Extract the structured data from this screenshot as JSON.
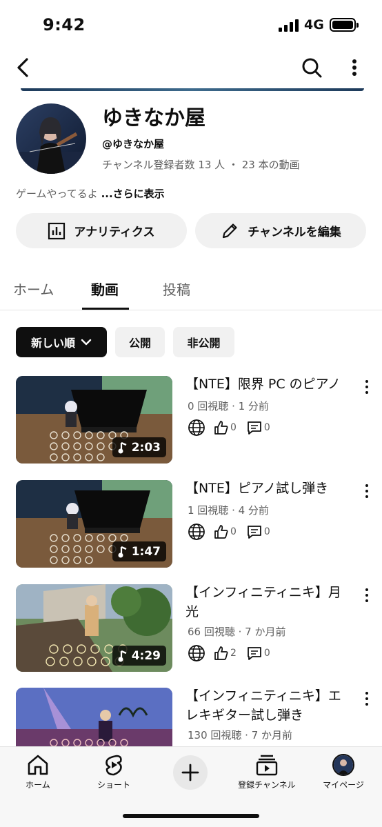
{
  "status": {
    "time": "9:42",
    "network": "4G"
  },
  "channel": {
    "name": "ゆきなか屋",
    "handle": "@ゆきなか屋",
    "meta": "チャンネル登録者数 13 人 ・ 23 本の動画",
    "description": "ゲームやってるよ ",
    "description_more": "...さらに表示"
  },
  "buttons": {
    "analytics": "アナリティクス",
    "edit_channel": "チャンネルを編集"
  },
  "tabs": [
    "ホーム",
    "動画",
    "投稿"
  ],
  "active_tab": "動画",
  "filters": {
    "sort": "新しい順",
    "public": "公開",
    "private": "非公開"
  },
  "videos": [
    {
      "title": "【NTE】限界 PC のピアノ",
      "meta": "0 回視聴 · 1 分前",
      "duration": "2:03",
      "likes": "0",
      "comments": "0"
    },
    {
      "title": "【NTE】ピアノ試し弾き",
      "meta": "1 回視聴 · 4 分前",
      "duration": "1:47",
      "likes": "0",
      "comments": "0"
    },
    {
      "title": "【インフィニティニキ】月光",
      "meta": "66 回視聴 · 7 か月前",
      "duration": "4:29",
      "likes": "2",
      "comments": "0"
    },
    {
      "title": "【インフィニティニキ】エレキギター試し弾き",
      "meta": "130 回視聴 · 7 か月前"
    }
  ],
  "nav": {
    "home": "ホーム",
    "shorts": "ショート",
    "subscriptions": "登録チャンネル",
    "you": "マイページ"
  },
  "icons": {
    "back": "back-arrow-icon",
    "search": "search-icon",
    "more": "more-vertical-icon",
    "analytics": "bar-chart-icon",
    "edit": "pencil-icon",
    "sort": "chevron-down-icon",
    "music": "music-note-icon",
    "visibility": "globe-icon",
    "like": "thumb-up-icon",
    "comment": "comment-icon",
    "home": "home-icon",
    "shorts": "shorts-icon",
    "create": "plus-icon",
    "subscriptions": "subscriptions-icon"
  }
}
